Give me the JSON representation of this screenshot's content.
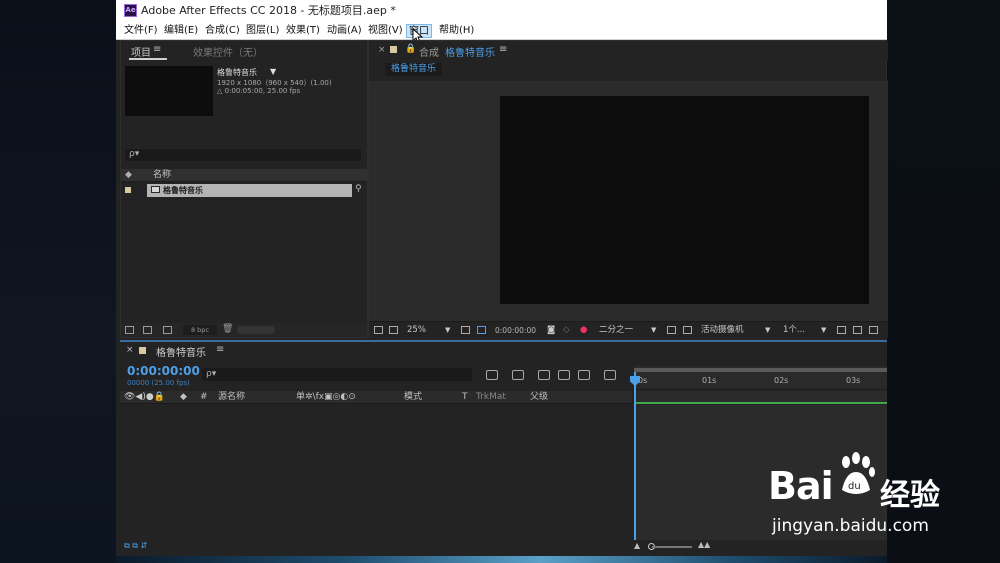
{
  "window": {
    "title": "Adobe After Effects CC 2018 - 无标题项目.aep *",
    "logo_text": "Ae"
  },
  "menu": [
    "文件(F)",
    "编辑(E)",
    "合成(C)",
    "图层(L)",
    "效果(T)",
    "动画(A)",
    "视图(V)",
    "窗口",
    "帮助(H)"
  ],
  "menu_hover_index": 7,
  "project_panel": {
    "tab_project": "项目",
    "tab_effects": "效果控件（无）",
    "comp_name": "格鲁特音乐",
    "comp_dims": "1920 x 1080（960 x 540）(1.00)",
    "comp_duration": "△ 0:00:05:00, 25.00 fps",
    "search_icon": "ρ▾",
    "column_name": "名称",
    "items": [
      {
        "name": "格鲁特音乐",
        "type": "composition"
      }
    ],
    "bpc": "8 bpc"
  },
  "comp_panel": {
    "close": "×",
    "label_prefix": "合成",
    "name": "格鲁特音乐",
    "subtab": "格鲁特音乐",
    "zoom": "25%",
    "timecode": "0:00:00:00",
    "resolution": "二分之一",
    "camera": "活动摄像机",
    "views": "1个..."
  },
  "timeline": {
    "tab_name": "格鲁特音乐",
    "timecode": "0:00:00:00",
    "timecode_sub": "00000 (25.00 fps)",
    "ruler": [
      "0s",
      "01s",
      "02s",
      "03s"
    ],
    "columns": {
      "layer_name": "源名称",
      "switches": "单✲\\fx▣◎◐⊙",
      "mode": "模式",
      "t": "T",
      "trkmat": "TrkMat",
      "parent": "父级"
    }
  },
  "watermark": {
    "logo": "Bai",
    "logo_paw": "du",
    "cn": "经验",
    "url": "jingyan.baidu.com"
  },
  "colors": {
    "accent_blue": "#4d9fe8",
    "panel_bg": "#232323",
    "work_area_green": "#3ea84a"
  }
}
